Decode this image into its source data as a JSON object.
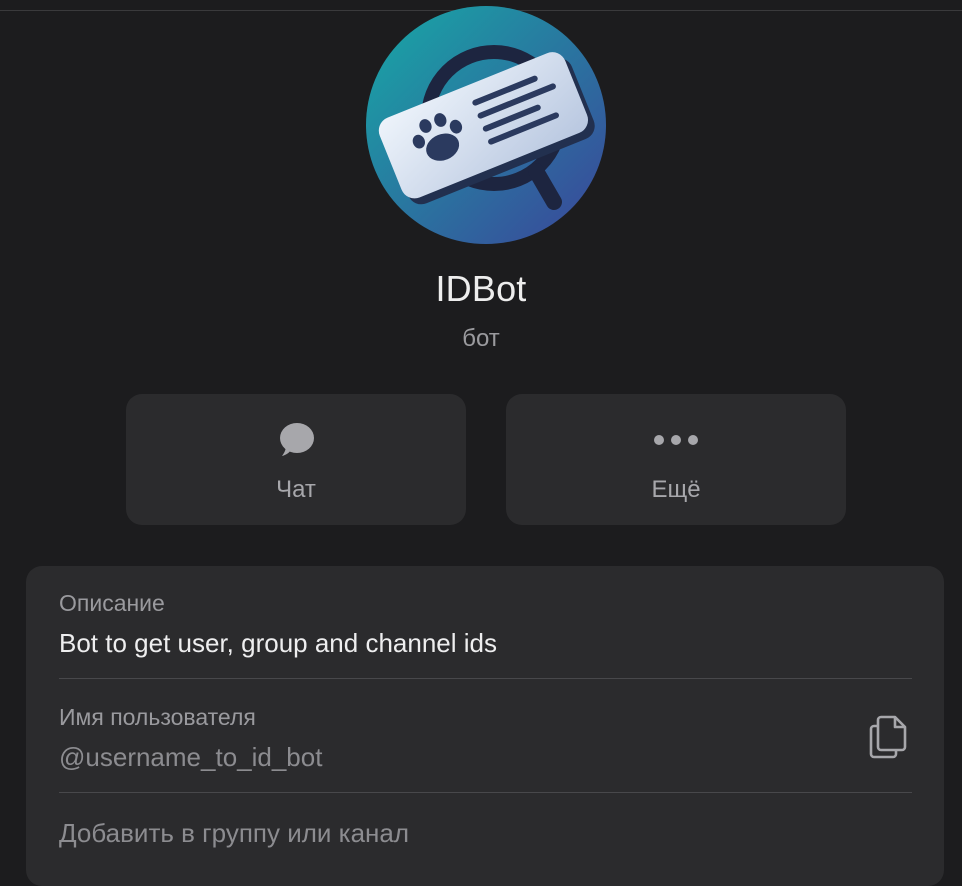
{
  "profile": {
    "name": "IDBot",
    "type": "бот",
    "avatar_icon": "id-card-magnifier-icon",
    "avatar_colors": [
      "#1aa0a0",
      "#3a4f9a"
    ]
  },
  "actions": {
    "chat": {
      "label": "Чат",
      "icon": "chat-bubble-icon"
    },
    "more": {
      "label": "Ещё",
      "icon": "more-dots-icon"
    }
  },
  "info": {
    "description_label": "Описание",
    "description_value": "Bot to get user, group and channel ids",
    "username_label": "Имя пользователя",
    "username_value": "@username_to_id_bot",
    "copy_icon": "copy-icon",
    "add_to_group": "Добавить в группу или канал"
  }
}
